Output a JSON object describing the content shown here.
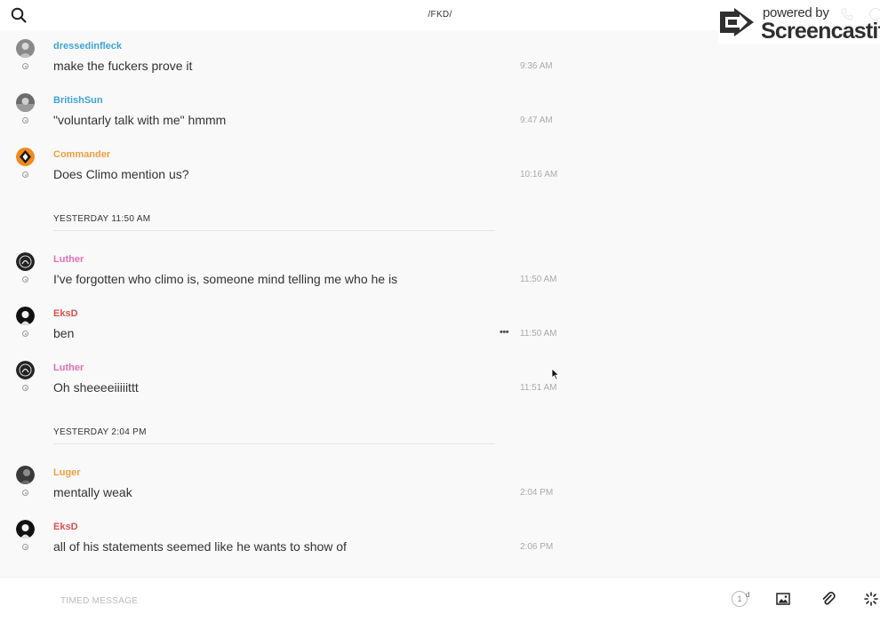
{
  "header": {
    "channel_title": "/FKD/",
    "search_icon": "search-icon",
    "phone_icon": "phone-icon",
    "info_icon": "info-icon"
  },
  "watermark": {
    "powered_text": "powered by",
    "brand_text": "Screencastify"
  },
  "colors": {
    "cyan_user": "#3fa4d8",
    "orange_user": "#f0a040",
    "pink_user": "#e36fb4",
    "red_user": "#d9534f"
  },
  "messages": [
    {
      "user": "dressedinfleck",
      "text": "make the fuckers prove it",
      "time": "9:36 AM",
      "color": "#3fa4d8"
    },
    {
      "user": "BritishSun",
      "text": "\"voluntarly talk with me\" hmmm",
      "time": "9:47 AM",
      "color": "#3fa4d8"
    },
    {
      "user": "Commander",
      "text": "Does Climo mention us?",
      "time": "10:16 AM",
      "color": "#f0a040"
    },
    {
      "user": "Luther",
      "text": "I've forgotten who climo is, someone mind telling me who he is",
      "time": "11:50 AM",
      "color": "#e36fb4"
    },
    {
      "user": "EksD",
      "text": "ben",
      "time": "11:50 AM",
      "color": "#d9534f",
      "more": "•••"
    },
    {
      "user": "Luther",
      "text": "Oh sheeeeiiiiittt",
      "time": "11:51 AM",
      "color": "#e36fb4"
    },
    {
      "user": "Luger",
      "text": "mentally weak",
      "time": "2:04 PM",
      "color": "#f0a040"
    },
    {
      "user": "EksD",
      "text": "all of his statements seemed like he wants to show of",
      "time": "2:06 PM",
      "color": "#d9534f"
    }
  ],
  "dividers": [
    {
      "label": "YESTERDAY 11:50 AM"
    },
    {
      "label": "YESTERDAY 2:04 PM"
    }
  ],
  "composer": {
    "placeholder": "TIMED MESSAGE",
    "timer_value": "1",
    "timer_unit": "d"
  }
}
